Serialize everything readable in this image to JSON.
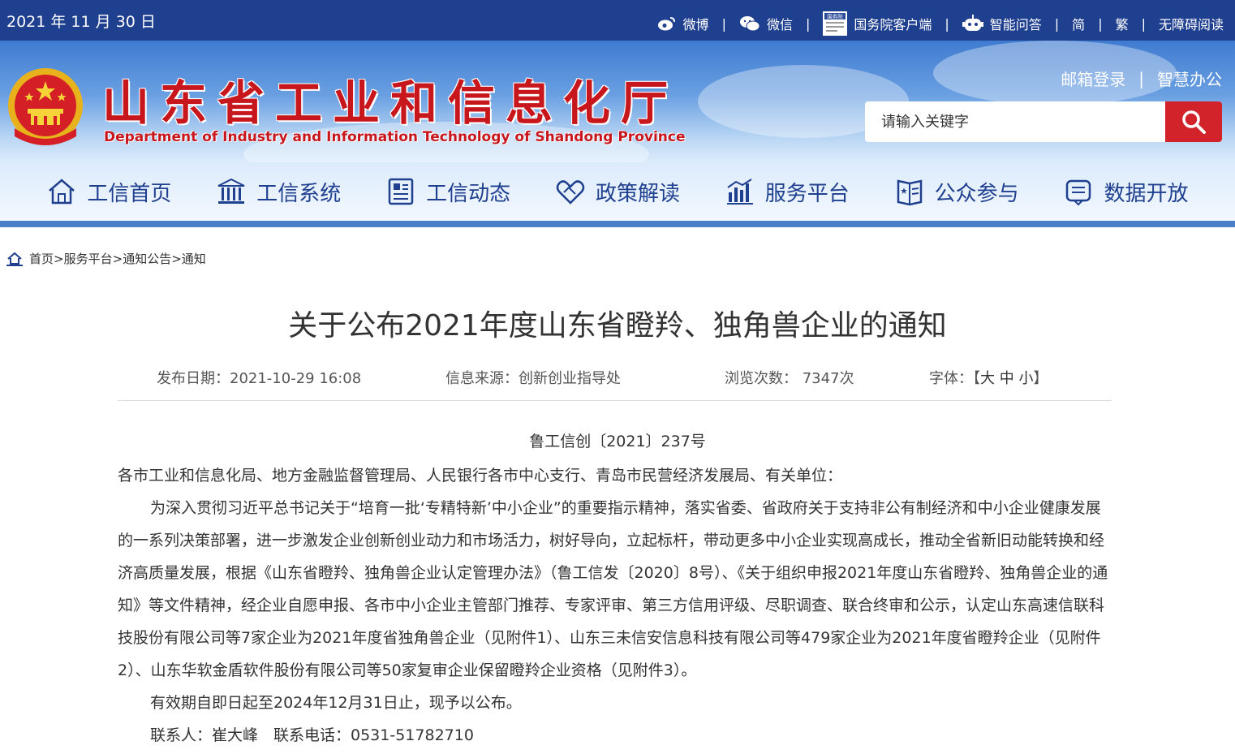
{
  "topbar": {
    "date": "2021 年 11 月 30 日",
    "links": [
      {
        "icon": "weibo-icon",
        "label": "微博"
      },
      {
        "icon": "wechat-icon",
        "label": "微信"
      },
      {
        "icon": "gov-app-icon",
        "label": "国务院客户端"
      },
      {
        "icon": "robot-icon",
        "label": "智能问答"
      },
      {
        "icon": "",
        "label": "简"
      },
      {
        "icon": "",
        "label": "繁"
      },
      {
        "icon": "",
        "label": "无障碍阅读"
      }
    ],
    "gov_app_badge": "国务院"
  },
  "header": {
    "title": "山东省工业和信息化厅",
    "subtitle": "Department of Industry and Information Technology of Shandong Province",
    "mail_login": "邮箱登录",
    "smart_office": "智慧办公",
    "search_placeholder": "请输入关键字"
  },
  "nav": [
    {
      "icon": "home-icon",
      "label": "工信首页"
    },
    {
      "icon": "building-icon",
      "label": "工信系统"
    },
    {
      "icon": "news-icon",
      "label": "工信动态"
    },
    {
      "icon": "handshake-icon",
      "label": "政策解读"
    },
    {
      "icon": "chart-icon",
      "label": "服务平台"
    },
    {
      "icon": "book-icon",
      "label": "公众参与"
    },
    {
      "icon": "data-icon",
      "label": "数据开放"
    }
  ],
  "breadcrumb": [
    "首页",
    "服务平台",
    "通知公告",
    "通知"
  ],
  "article": {
    "title": "关于公布2021年度山东省瞪羚、独角兽企业的通知",
    "publish_date": "发布日期：2021-10-29 16:08",
    "source": "信息来源：创新创业指导处",
    "views": "浏览次数：  7347次",
    "font_label": "字体：",
    "font_sizes": [
      "大",
      "中",
      "小"
    ],
    "doc_no": "鲁工信创〔2021〕237号",
    "paragraphs": [
      "各市工业和信息化局、地方金融监督管理局、人民银行各市中心支行、青岛市民营经济发展局、有关单位：",
      "为深入贯彻习近平总书记关于“培育一批‘专精特新’中小企业”的重要指示精神，落实省委、省政府关于支持非公有制经济和中小企业健康发展的一系列决策部署，进一步激发企业创新创业动力和市场活力，树好导向，立起标杆，带动更多中小企业实现高成长，推动全省新旧动能转换和经济高质量发展，根据《山东省瞪羚、独角兽企业认定管理办法》（鲁工信发〔2020〕8号）、《关于组织申报2021年度山东省瞪羚、独角兽企业的通知》等文件精神，经企业自愿申报、各市中小企业主管部门推荐、专家评审、第三方信用评级、尽职调查、联合终审和公示，认定山东高速信联科技股份有限公司等7家企业为2021年度省独角兽企业（见附件1）、山东三未信安信息科技有限公司等479家企业为2021年度省瞪羚企业（见附件2）、山东华软金盾软件股份有限公司等50家复审企业保留瞪羚企业资格（见附件3）。",
      "有效期自即日起至2024年12月31日止，现予以公布。",
      "联系人：崔大峰　联系电话：0531-51782710"
    ]
  },
  "colors": {
    "topbar": "#1f3f8f",
    "brand_red": "#c8161d",
    "search_button": "#d2232a",
    "nav_text": "#1f3f8f"
  }
}
